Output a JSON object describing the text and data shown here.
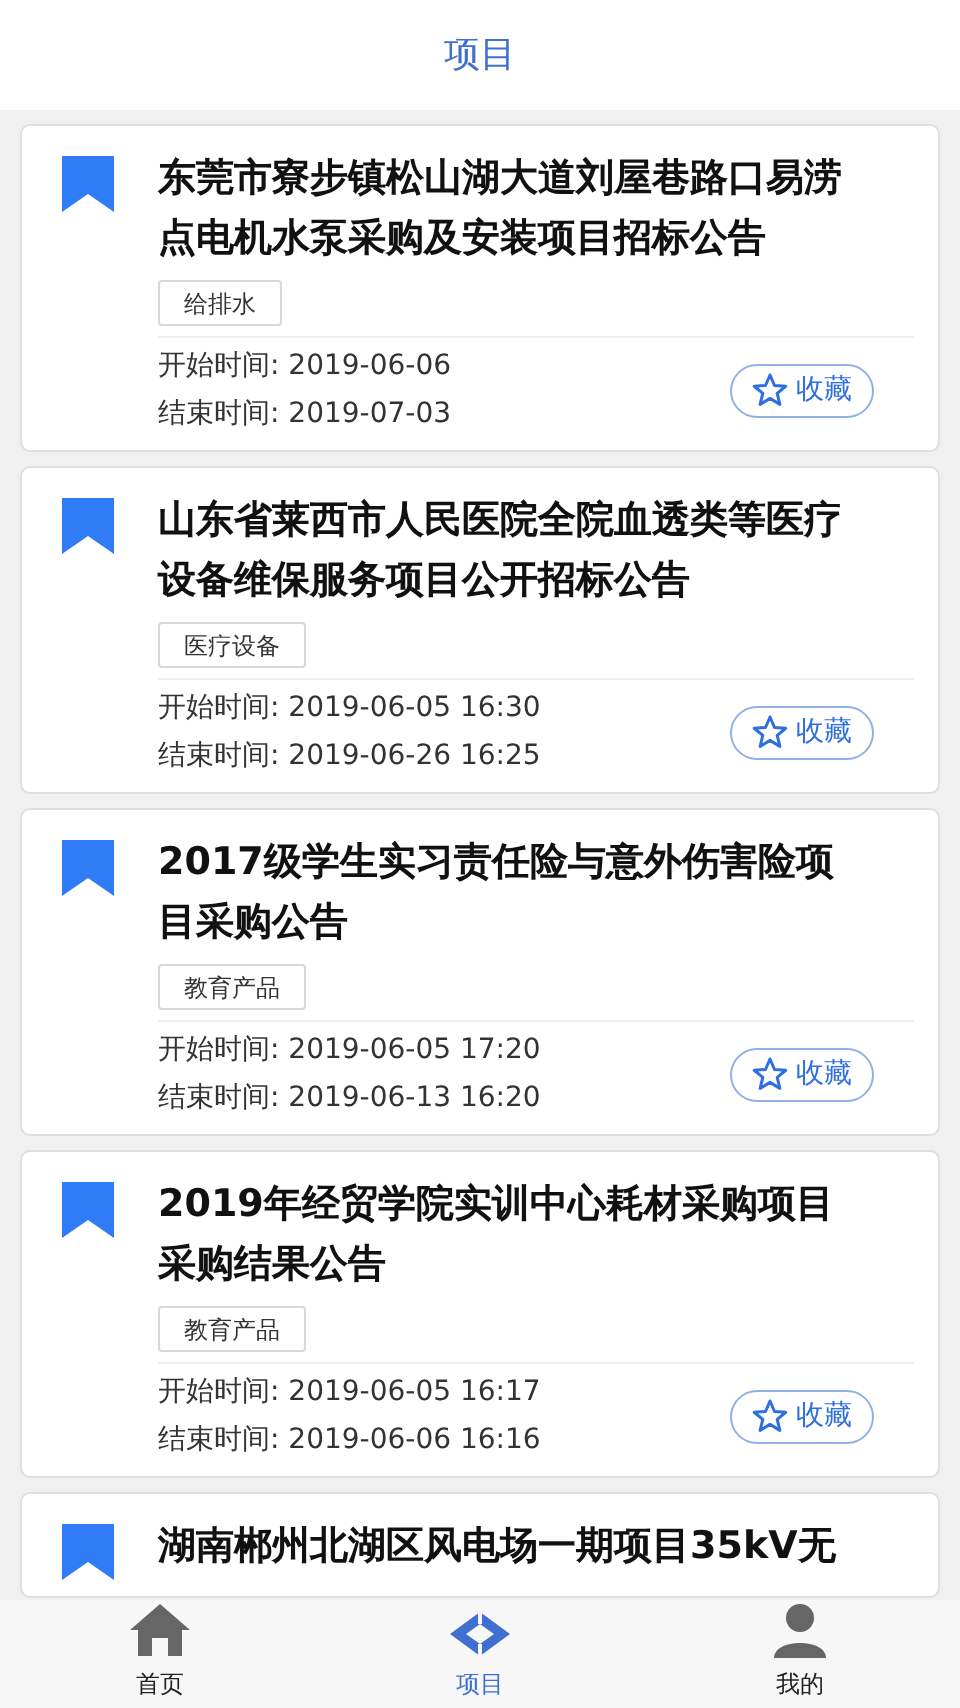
{
  "header": {
    "title": "项目"
  },
  "projects": [
    {
      "title": "东莞市寮步镇松山湖大道刘屋巷路口易涝点电机水泵采购及安装项目招标公告",
      "tag": "给排水",
      "start": "开始时间: 2019-06-06",
      "end": "结束时间: 2019-07-03",
      "collect_label": "收藏",
      "collected": false
    },
    {
      "title": "山东省莱西市人民医院全院血透类等医疗设备维保服务项目公开招标公告",
      "tag": "医疗设备",
      "start": "开始时间: 2019-06-05 16:30",
      "end": "结束时间: 2019-06-26 16:25",
      "collect_label": "收藏",
      "collected": false
    },
    {
      "title": "2017级学生实习责任险与意外伤害险项目采购公告",
      "tag": "教育产品",
      "start": "开始时间: 2019-06-05 17:20",
      "end": "结束时间: 2019-06-13 16:20",
      "collect_label": "收藏",
      "collected": false
    },
    {
      "title": "2019年经贸学院实训中心耗材采购项目采购结果公告",
      "tag": "教育产品",
      "start": "开始时间: 2019-06-05 16:17",
      "end": "结束时间: 2019-06-06 16:16",
      "collect_label": "收藏",
      "collected": false
    },
    {
      "title": "湖南郴州北湖区风电场一期项目35kV无"
    }
  ],
  "bottom_nav": [
    {
      "kind": "home",
      "label": "首页",
      "selected": false
    },
    {
      "kind": "projects",
      "label": "项目",
      "selected": true
    },
    {
      "kind": "profile",
      "label": "我的",
      "selected": false
    }
  ]
}
